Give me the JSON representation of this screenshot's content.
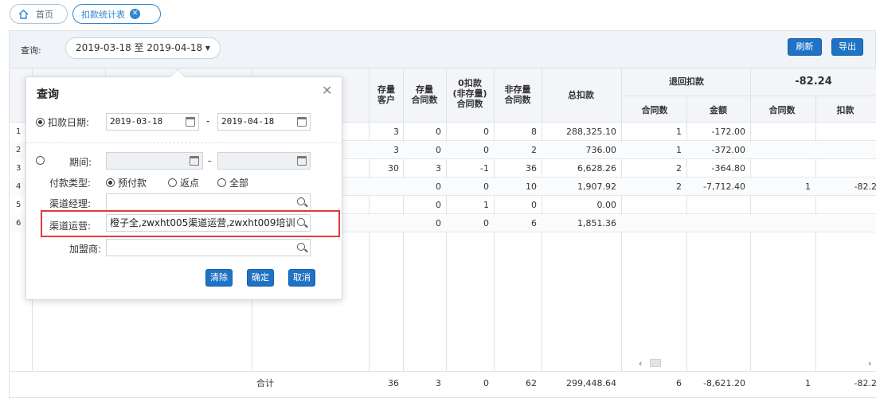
{
  "tabs": {
    "home": "首页",
    "active": "扣款统计表",
    "close_glyph": "✕"
  },
  "querybar": {
    "label": "查询:",
    "date_range": "2019-03-18 至 2019-04-18 ▾",
    "refresh": "刷新",
    "export": "导出"
  },
  "table": {
    "headers": {
      "stock_customer": "存量\n客户",
      "stock_contracts": "存量\n合同数",
      "zero_deduct": "0扣款\n(非存量)\n合同数",
      "nonstock_contracts": "非存量\n合同数",
      "total_deduct": "总扣款",
      "refund_group": "退回扣款",
      "refund_count": "合同数",
      "refund_amount": "金额",
      "group2": "-82.24",
      "g2_count": "合同数",
      "g2_deduct": "扣款"
    },
    "rows": [
      {
        "n": "1",
        "a": "3",
        "b": "0",
        "c": "0",
        "d": "8",
        "total": "288,325.10",
        "rc": "1",
        "ra": "-172.00",
        "gc": "",
        "gd": ""
      },
      {
        "n": "2",
        "a": "3",
        "b": "0",
        "c": "0",
        "d": "2",
        "total": "736.00",
        "rc": "1",
        "ra": "-372.00",
        "gc": "",
        "gd": ""
      },
      {
        "n": "3",
        "a": "30",
        "b": "3",
        "c": "-1",
        "d": "36",
        "total": "6,628.26",
        "rc": "2",
        "ra": "-364.80",
        "gc": "",
        "gd": ""
      },
      {
        "n": "4",
        "a": "",
        "b": "0",
        "c": "0",
        "d": "10",
        "total": "1,907.92",
        "rc": "2",
        "ra": "-7,712.40",
        "gc": "1",
        "gd": "-82.2"
      },
      {
        "n": "5",
        "a": "",
        "b": "0",
        "c": "1",
        "d": "0",
        "total": "0.00",
        "rc": "",
        "ra": "",
        "gc": "",
        "gd": ""
      },
      {
        "n": "6",
        "a": "",
        "b": "0",
        "c": "0",
        "d": "6",
        "total": "1,851.36",
        "rc": "",
        "ra": "",
        "gc": "",
        "gd": ""
      }
    ],
    "footer": {
      "label": "合计",
      "a": "36",
      "b": "3",
      "c": "0",
      "d": "62",
      "total": "299,448.64",
      "rc": "6",
      "ra": "-8,621.20",
      "gc": "1",
      "gd": "-82.2"
    },
    "scroll_left": "‹",
    "scroll_right": "›"
  },
  "popup": {
    "title": "查询",
    "close": "✕",
    "deduct_date_label": "扣款日期:",
    "date_from": "2019-03-18",
    "date_to": "2019-04-18",
    "dash": "-",
    "period_label": "期间:",
    "pay_type_label": "付款类型:",
    "pay_opt1": "预付款",
    "pay_opt2": "返点",
    "pay_opt3": "全部",
    "channel_manager_label": "渠道经理:",
    "channel_ops_label": "渠道运营:",
    "channel_ops_value": "橙子全,zwxht005渠道运营,zwxht009培训",
    "franchisee_label": "加盟商:",
    "btn_clear": "清除",
    "btn_ok": "确定",
    "btn_cancel": "取消"
  }
}
